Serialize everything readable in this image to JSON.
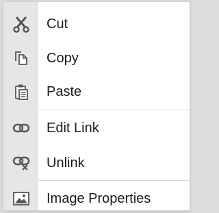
{
  "menu": {
    "items": [
      {
        "label": "Cut",
        "icon": "scissors-icon"
      },
      {
        "label": "Copy",
        "icon": "copy-icon"
      },
      {
        "label": "Paste",
        "icon": "paste-icon"
      },
      {
        "label": "Edit Link",
        "icon": "link-icon"
      },
      {
        "label": "Unlink",
        "icon": "unlink-icon"
      },
      {
        "label": "Image Properties",
        "icon": "image-icon"
      }
    ]
  },
  "colors": {
    "menu_bg": "#ffffff",
    "icon_gutter": "#e6e6e6",
    "separator": "#d9d9d9",
    "icon": "#555555",
    "text": "#1a1a1a"
  }
}
